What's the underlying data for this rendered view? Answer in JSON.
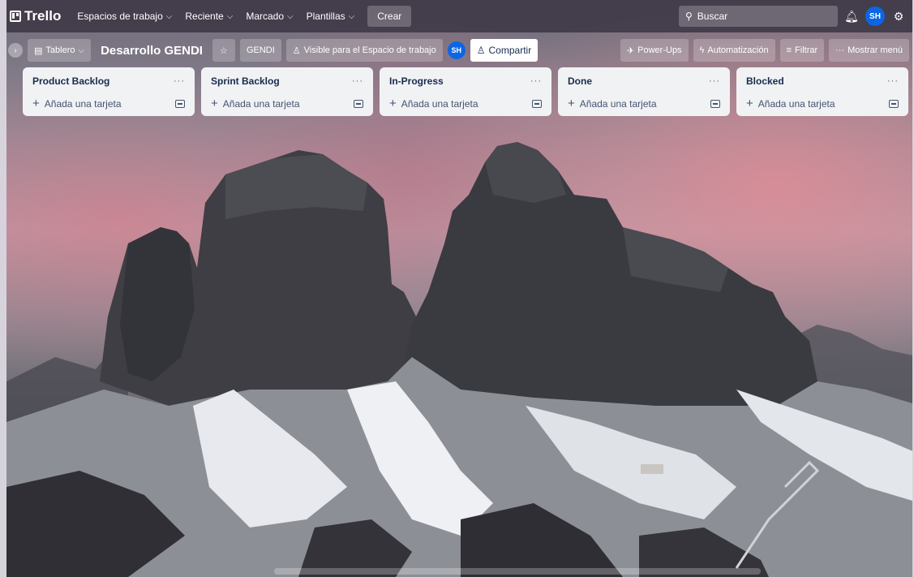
{
  "topnav": {
    "logo": "Trello",
    "workspaces": "Espacios de trabajo",
    "recent": "Reciente",
    "starred": "Marcado",
    "templates": "Plantillas",
    "create": "Crear",
    "search_placeholder": "Buscar",
    "avatar_initials": "SH"
  },
  "board": {
    "view": "Tablero",
    "title": "Desarrollo GENDI",
    "workspace_chip": "GENDI",
    "visibility": "Visible para el Espacio de trabajo",
    "member_initials": "SH",
    "share": "Compartir",
    "powerups": "Power-Ups",
    "automation": "Automatización",
    "filter": "Filtrar",
    "show_menu": "Mostrar menú"
  },
  "lists": [
    {
      "title": "Product Backlog",
      "add_card": "Añada una tarjeta"
    },
    {
      "title": "Sprint Backlog",
      "add_card": "Añada una tarjeta"
    },
    {
      "title": "In-Progress",
      "add_card": "Añada una tarjeta"
    },
    {
      "title": "Done",
      "add_card": "Añada una tarjeta"
    },
    {
      "title": "Blocked",
      "add_card": "Añada una tarjeta"
    }
  ],
  "icons": {
    "chevron": "chevron-down-icon",
    "search": "search-icon",
    "bell": "bell-icon",
    "settings": "settings-icon"
  },
  "colors": {
    "topnav_bg": "#403a48",
    "avatar": "#0c66e4",
    "list_bg": "#f1f2f4",
    "list_text": "#172b4d"
  }
}
